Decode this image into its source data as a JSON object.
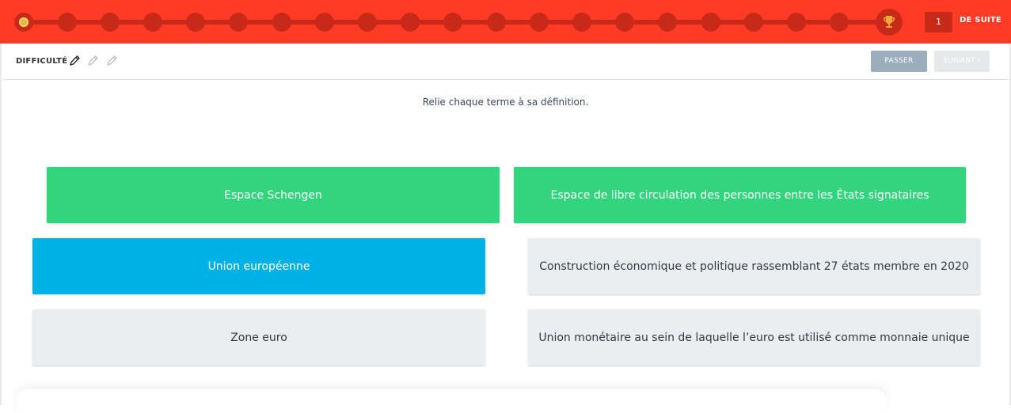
{
  "progress": {
    "streak_count": "1",
    "streak_label": "DE SUITE",
    "colors": {
      "bar": "#ff3b26",
      "track": "#c82a1a",
      "current_step": "#f2b33d"
    }
  },
  "toolbar": {
    "difficulty_label": "DIFFICULTÉ",
    "difficulty_level": "1 of 3",
    "skip_label": "PASSER",
    "next_label": "SUIVANT ›"
  },
  "exercise": {
    "instruction": "Relie chaque terme à sa définition.",
    "cards": [
      {
        "text": "Espace Schengen",
        "state": "matched"
      },
      {
        "text": "Espace de libre circulation des personnes entre les États signataires",
        "state": "matched"
      },
      {
        "text": "Union européenne",
        "state": "selected"
      },
      {
        "text": "Construction économique et politique rassemblant 27 états membre en 2020",
        "state": "default"
      },
      {
        "text": "Zone euro",
        "state": "default"
      },
      {
        "text": "Union monétaire au sein de laquelle l’euro est utilisé comme monnaie unique",
        "state": "default"
      }
    ],
    "colors": {
      "matched": "#32d47d",
      "selected": "#00b1e6",
      "default": "#eaeef1"
    }
  }
}
